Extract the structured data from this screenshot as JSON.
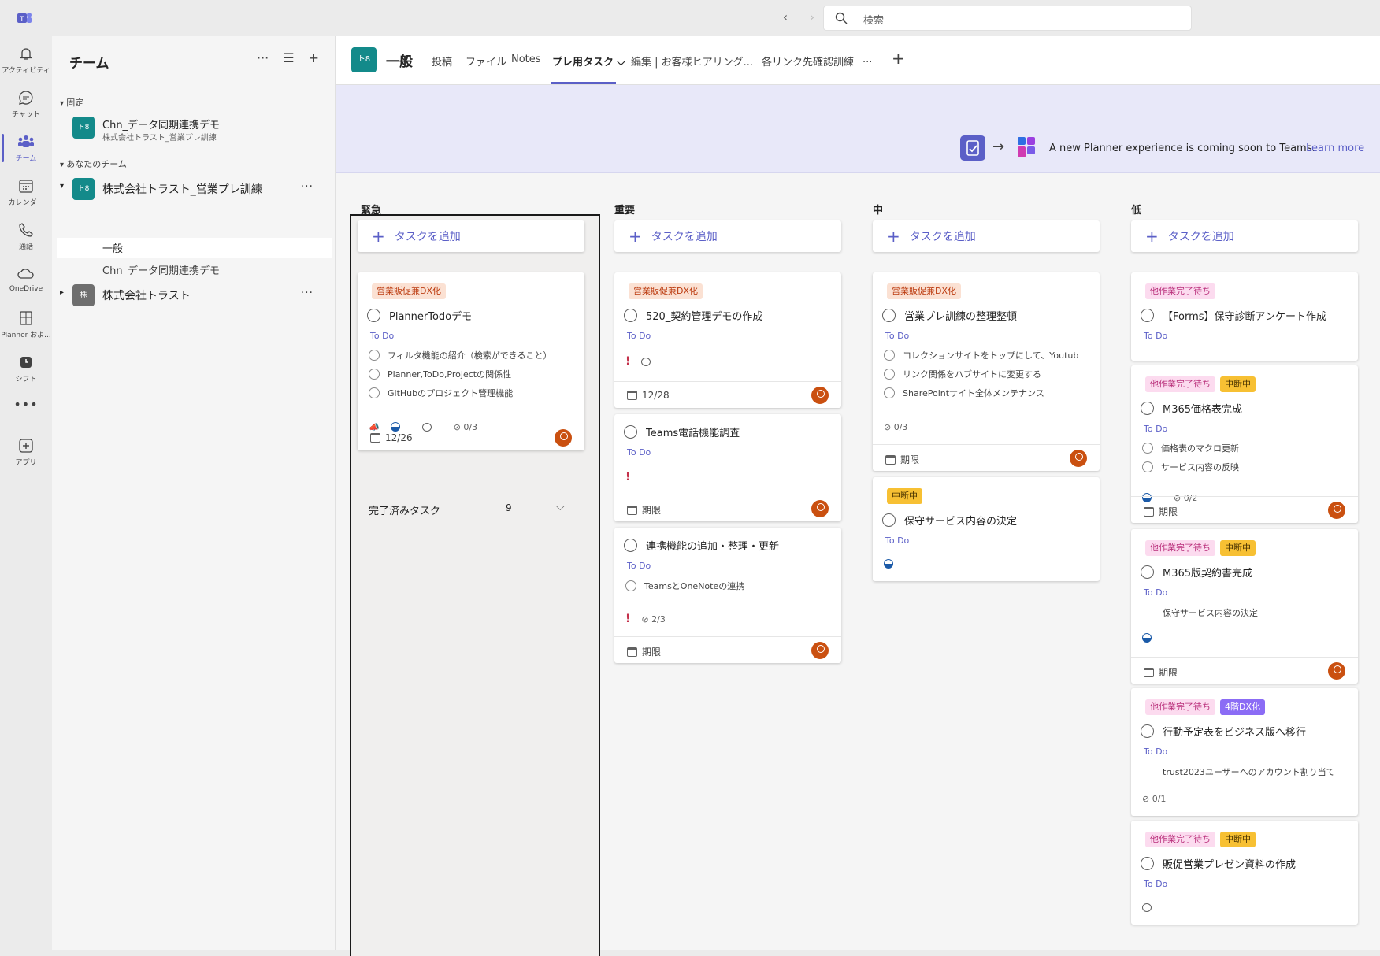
{
  "search": {
    "placeholder": "検索"
  },
  "rail": [
    {
      "name": "rail-activity",
      "icon": "bell-icon",
      "label": "アクティビティ"
    },
    {
      "name": "rail-chat",
      "icon": "chat-icon",
      "label": "チャット"
    },
    {
      "name": "rail-teams",
      "icon": "teams-icon",
      "label": "チーム"
    },
    {
      "name": "rail-calendar",
      "icon": "calendar-icon",
      "label": "カレンダー"
    },
    {
      "name": "rail-calls",
      "icon": "phone-icon",
      "label": "通話"
    },
    {
      "name": "rail-onedrive",
      "icon": "cloud-icon",
      "label": "OneDrive"
    },
    {
      "name": "rail-planner",
      "icon": "planner-icon",
      "label": "Planner およ..."
    },
    {
      "name": "rail-shifts",
      "icon": "clock-icon",
      "label": "シフト"
    },
    {
      "name": "rail-more",
      "icon": "ellipsis-icon",
      "label": ""
    },
    {
      "name": "rail-apps",
      "icon": "plus-box-icon",
      "label": "アプリ"
    }
  ],
  "sidebar": {
    "title": "チーム",
    "pinned_label": "固定",
    "pinned_team": {
      "tile": "ト8",
      "name": "Chn_データ同期連携デモ",
      "sub": "株式会社トラスト_営業プレ訓練"
    },
    "your_teams_label": "あなたのチーム",
    "teams": [
      {
        "tile": "ト8",
        "name": "株式会社トラスト_営業プレ訓練",
        "channels": [
          "一般",
          "Chn_データ同期連携デモ"
        ]
      },
      {
        "tile": "株",
        "name": "株式会社トラスト"
      }
    ]
  },
  "header": {
    "tile": "ト8",
    "title": "一般",
    "tabs": [
      "投稿",
      "ファイル",
      "Notes",
      "プレ用タスク",
      "編集 | お客様ヒアリング...",
      "各リンク先確認訓練",
      "..."
    ],
    "active_tab_chevron": "⌵"
  },
  "banner": {
    "text": "A new Planner experience is coming soon to Teams.",
    "link": "Learn more"
  },
  "board": {
    "add_task": "タスクを追加",
    "todo": "To Do",
    "no_due": "期限",
    "buckets": [
      {
        "title": "緊急"
      },
      {
        "title": "重要"
      },
      {
        "title": "中"
      },
      {
        "title": "低"
      }
    ],
    "completed": {
      "label": "完了済みタスク",
      "count": "9"
    },
    "cards": {
      "u1": {
        "labels": [
          "営業販促兼DX化"
        ],
        "title": "PlannerTodoデモ",
        "checklist": [
          "フィルタ機能の紹介（検索ができること）",
          "Planner,ToDo,Projectの関係性",
          "GitHubのプロジェクト管理機能"
        ],
        "progress": "0/3",
        "due": "12/26"
      },
      "i1": {
        "labels": [
          "営業販促兼DX化"
        ],
        "title": "520_契約管理デモの作成",
        "due": "12/28"
      },
      "i2": {
        "title": "Teams電話機能調査"
      },
      "i3": {
        "title": "連携機能の追加・整理・更新",
        "checklist": [
          "TeamsとOneNoteの連携"
        ],
        "progress": "2/3"
      },
      "m1": {
        "labels": [
          "営業販促兼DX化"
        ],
        "title": "営業プレ訓練の整理整頓",
        "checklist": [
          "コレクションサイトをトップにして、Youtub",
          "リンク関係をハブサイトに変更する",
          "SharePointサイト全体メンテナンス"
        ],
        "progress": "0/3"
      },
      "m2": {
        "labels": [
          "中断中"
        ],
        "title": "保守サービス内容の決定"
      },
      "l1": {
        "labels": [
          "他作業完了待ち"
        ],
        "title": "【Forms】保守診断アンケート作成"
      },
      "l2": {
        "labels": [
          "他作業完了待ち",
          "中断中"
        ],
        "title": "M365価格表完成",
        "checklist": [
          "価格表のマクロ更新",
          "サービス内容の反映"
        ],
        "progress": "0/2"
      },
      "l3": {
        "labels": [
          "他作業完了待ち",
          "中断中"
        ],
        "title": "M365版契約書完成",
        "note": "保守サービス内容の決定"
      },
      "l4": {
        "labels": [
          "他作業完了待ち",
          "4階DX化"
        ],
        "title": "行動予定表をビジネス版へ移行",
        "note": "trust2023ユーザーへのアカウント割り当て",
        "progress": "0/1"
      },
      "l5": {
        "labels": [
          "他作業完了待ち",
          "中断中"
        ],
        "title": "販促営業プレゼン資料の作成"
      }
    }
  },
  "colors": {
    "accent": "#5b5fc7",
    "team_tile": "#138a8a",
    "avatar": "#ca5010",
    "important": "#c4314b"
  }
}
